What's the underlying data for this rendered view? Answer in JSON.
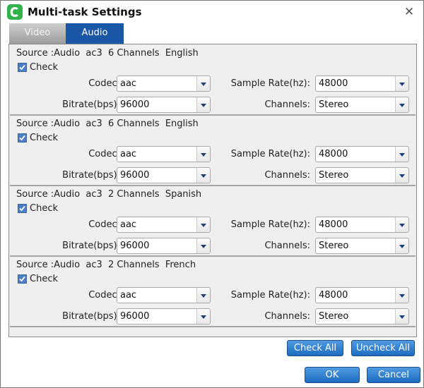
{
  "window": {
    "title": "Multi-task Settings",
    "app_icon": "app-logo-icon",
    "close_icon": "close-icon",
    "close_glyph": "✕"
  },
  "tabs": [
    {
      "label": "Video",
      "active": false
    },
    {
      "label": "Audio",
      "active": true
    }
  ],
  "labels": {
    "codec": "Codec:",
    "bitrate": "Bitrate(bps):",
    "sample_rate": "Sample Rate(hz):",
    "channels": "Channels:",
    "check": "Check"
  },
  "tracks": [
    {
      "source": "Source :Audio  ac3  6 Channels  English",
      "checked": true,
      "codec": "aac",
      "bitrate": "96000",
      "sample_rate": "48000",
      "channels": "Stereo"
    },
    {
      "source": "Source :Audio  ac3  6 Channels  English",
      "checked": true,
      "codec": "aac",
      "bitrate": "96000",
      "sample_rate": "48000",
      "channels": "Stereo"
    },
    {
      "source": "Source :Audio  ac3  2 Channels  Spanish",
      "checked": true,
      "codec": "aac",
      "bitrate": "96000",
      "sample_rate": "48000",
      "channels": "Stereo"
    },
    {
      "source": "Source :Audio  ac3  2 Channels  French",
      "checked": true,
      "codec": "aac",
      "bitrate": "96000",
      "sample_rate": "48000",
      "channels": "Stereo"
    }
  ],
  "buttons": {
    "check_all": "Check All",
    "uncheck_all": "Uncheck All",
    "ok": "OK",
    "cancel": "Cancel"
  },
  "colors": {
    "accent": "#1a56a6",
    "button": "#1d6cc2",
    "checkbox": "#4a7fc8",
    "app_icon": "#2fb34a"
  }
}
